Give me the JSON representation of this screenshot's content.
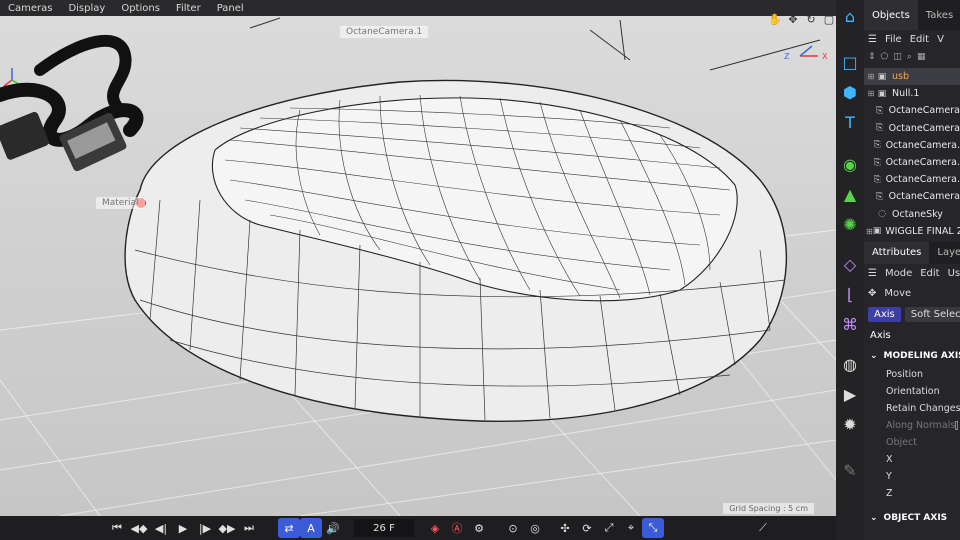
{
  "view_menu": [
    "Cameras",
    "Display",
    "Options",
    "Filter",
    "Panel"
  ],
  "viewport": {
    "camera_label": "OctaneCamera.1",
    "material_label": "Material",
    "grid_spacing": "Grid Spacing : 5 cm",
    "axis_label_z": "Z",
    "axis_label_x": "X"
  },
  "timeline": {
    "frame": "26 F"
  },
  "right_panel": {
    "tabs": [
      "Objects",
      "Takes"
    ],
    "menu": [
      "File",
      "Edit",
      "V"
    ],
    "objects": [
      {
        "label": "usb",
        "icon": "layer-icon",
        "selected": true
      },
      {
        "label": "Null.1",
        "icon": "layer-icon",
        "selected": false
      },
      {
        "label": "OctaneCamera",
        "icon": "camera-icon",
        "selected": false
      },
      {
        "label": "OctaneCamera",
        "icon": "camera-icon",
        "selected": false
      },
      {
        "label": "OctaneCamera.",
        "icon": "camera-icon",
        "selected": false
      },
      {
        "label": "OctaneCamera.",
        "icon": "camera-icon",
        "selected": false
      },
      {
        "label": "OctaneCamera.",
        "icon": "camera-icon",
        "selected": false
      },
      {
        "label": "OctaneCamera",
        "icon": "camera-icon",
        "selected": false
      },
      {
        "label": "OctaneSky",
        "icon": "sky-icon",
        "selected": false
      },
      {
        "label": "WIGGLE FINAL 2",
        "icon": "layer-icon",
        "selected": false
      }
    ],
    "attr_tabs": [
      "Attributes",
      "Layers"
    ],
    "attr_menu": [
      "Mode",
      "Edit",
      "Us"
    ],
    "tool_name": "Move",
    "sub_tabs": [
      "Axis",
      "Soft Selectio"
    ],
    "section_title": "Axis",
    "modeling_axis_head": "MODELING AXIS",
    "modeling_axis_rows": [
      "Position",
      "Orientation",
      "Retain Changes",
      "Along Normals",
      "Object",
      "X",
      "Y",
      "Z"
    ],
    "object_axis_head": "OBJECT AXIS"
  }
}
